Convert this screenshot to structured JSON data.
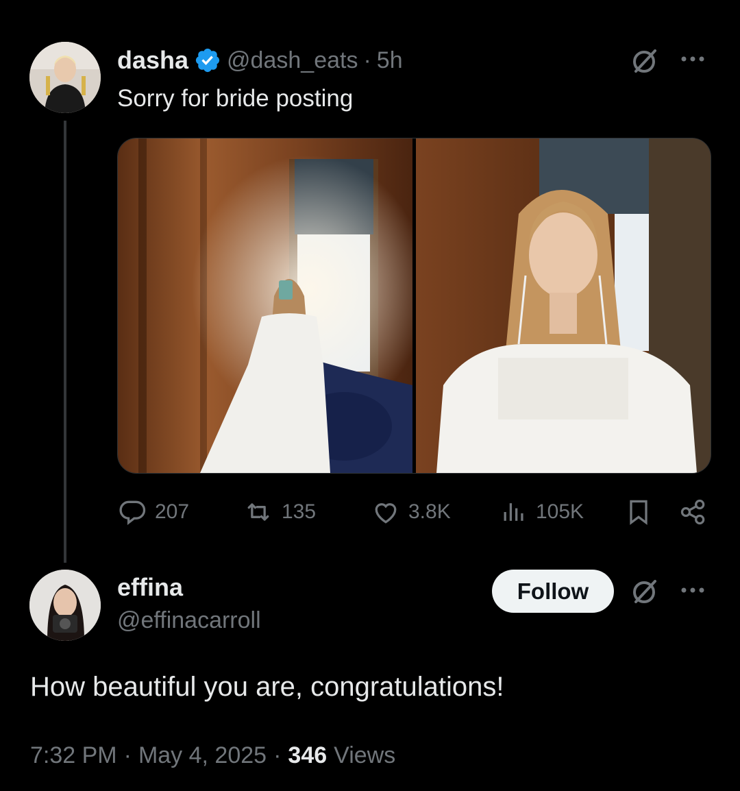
{
  "tweet": {
    "display_name": "dasha",
    "handle": "@dash_eats",
    "separator": "·",
    "time": "5h",
    "text": "Sorry for bride posting",
    "actions": {
      "replies": "207",
      "reposts": "135",
      "likes": "3.8K",
      "views": "105K"
    }
  },
  "reply": {
    "display_name": "effina",
    "handle": "@effinacarroll",
    "follow_label": "Follow",
    "text": "How beautiful you are, congratulations!",
    "time": "7:32 PM",
    "sep1": "·",
    "date": "May 4, 2025",
    "sep2": "·",
    "views_count": "346",
    "views_label": "Views"
  },
  "icons": {
    "verified": "verified-badge-icon",
    "grok": "grok-icon",
    "more": "more-icon",
    "reply": "reply-icon",
    "repost": "repost-icon",
    "like": "like-icon",
    "views": "views-icon",
    "bookmark": "bookmark-icon",
    "share": "share-icon"
  },
  "colors": {
    "background": "#000000",
    "text": "#e7e9ea",
    "secondary": "#71767b",
    "verified_blue": "#1d9bf0",
    "follow_bg": "#eff3f4"
  }
}
